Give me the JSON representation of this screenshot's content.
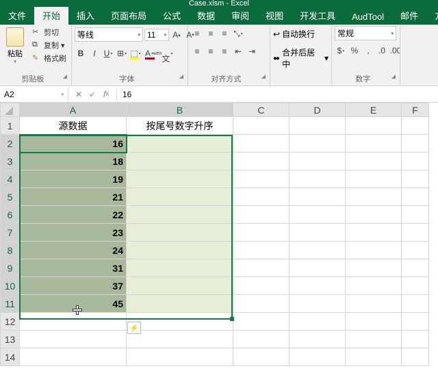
{
  "title": "Case.xlsm - Excel",
  "tabs": [
    "文件",
    "开始",
    "插入",
    "页面布局",
    "公式",
    "数据",
    "审阅",
    "视图",
    "开发工具",
    "AudTool",
    "邮件",
    "方方格子"
  ],
  "active_tab_index": 1,
  "clipboard": {
    "paste": "粘贴",
    "cut": "剪切",
    "copy": "复制",
    "format_painter": "格式刷",
    "label": "剪贴板"
  },
  "font": {
    "name": "等线",
    "size": "11",
    "label": "字体"
  },
  "alignment": {
    "wrap": "自动换行",
    "merge": "合并后居中",
    "label": "对齐方式"
  },
  "number": {
    "format": "常规",
    "label": "数字"
  },
  "namebox": "A2",
  "formula": "16",
  "columns": [
    "A",
    "B",
    "C",
    "D",
    "E",
    "F"
  ],
  "rows": [
    1,
    2,
    3,
    4,
    5,
    6,
    7,
    8,
    9,
    10,
    11,
    12,
    13,
    14
  ],
  "headers": {
    "A": "源数据",
    "B": "按尾号数字升序"
  },
  "colA_data": [
    "16",
    "18",
    "19",
    "21",
    "22",
    "23",
    "24",
    "31",
    "37",
    "45"
  ],
  "selection": {
    "range": "A2:B11",
    "active": "A2"
  }
}
